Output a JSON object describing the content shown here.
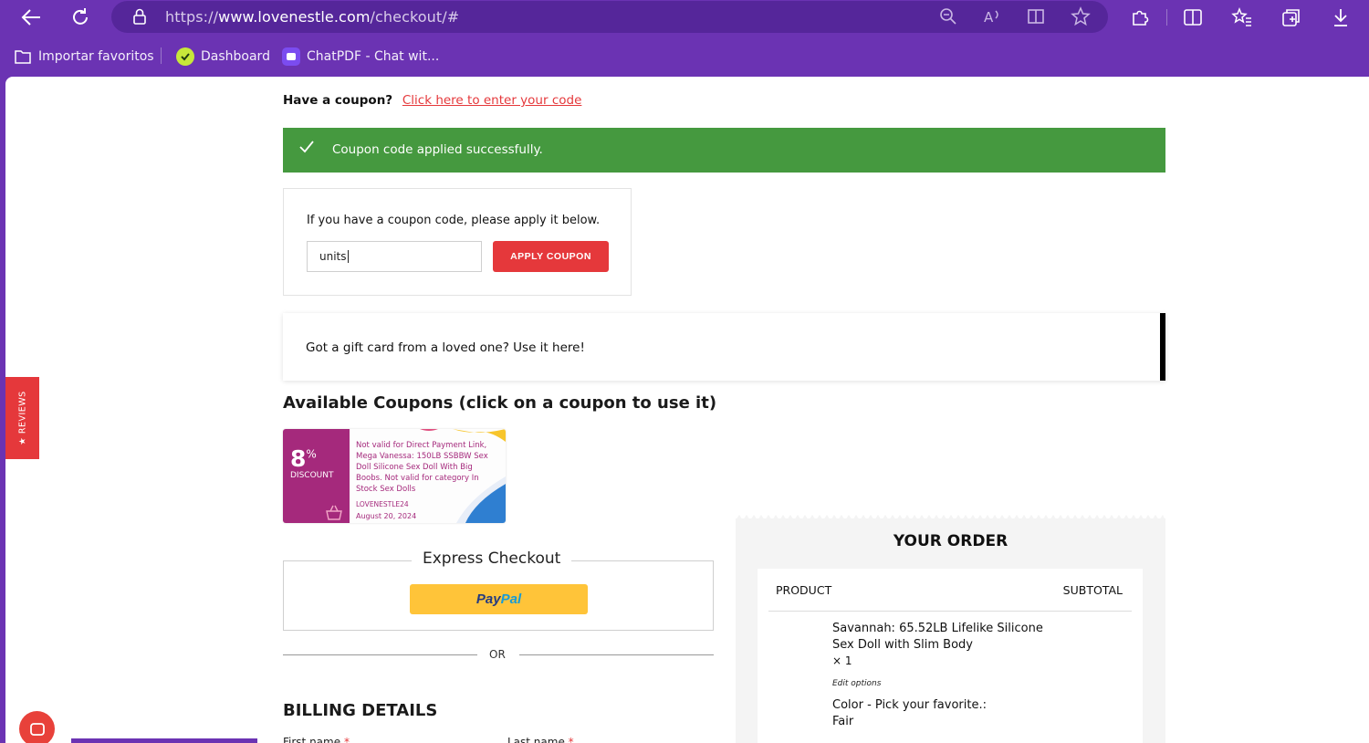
{
  "browser": {
    "url_prefix": "https://",
    "url_host": "www.lovenestle.com",
    "url_path": "/checkout/#",
    "bookmarks": [
      {
        "label": "Importar favoritos"
      },
      {
        "label": "Dashboard"
      },
      {
        "label": "ChatPDF - Chat wit..."
      }
    ]
  },
  "coupon_prompt": {
    "question": "Have a coupon?",
    "link": "Click here to enter your code"
  },
  "notice": {
    "message": "Coupon code applied successfully."
  },
  "coupon_form": {
    "label": "If you have a coupon code, please apply it below.",
    "value": "units",
    "button": "APPLY COUPON"
  },
  "gift_card": {
    "text": "Got a gift card from a loved one? Use it here!"
  },
  "available_coupons": {
    "title": "Available Coupons (click on a coupon to use it)",
    "items": [
      {
        "amount": "8",
        "unit": "%",
        "label": "DISCOUNT",
        "description": "Not valid for Direct Payment Link, Mega Vanessa: 150LB SSBBW Sex Doll Silicone Sex Doll With Big Boobs. Not valid for category In Stock Sex Dolls",
        "code": "LOVENESTLE24",
        "expiry": "August 20, 2024"
      }
    ]
  },
  "express_checkout": {
    "title": "Express Checkout",
    "paypal_a": "Pay",
    "paypal_b": "Pal"
  },
  "divider": {
    "text": "OR"
  },
  "billing": {
    "title": "BILLING DETAILS",
    "first_name": "First name",
    "last_name": "Last name",
    "required_mark": "*"
  },
  "order": {
    "title": "YOUR ORDER",
    "col_product": "PRODUCT",
    "col_subtotal": "SUBTOTAL",
    "item_name": "Savannah: 65.52LB Lifelike Silicone Sex Doll with Slim Body",
    "item_qty": "× 1",
    "edit_options": "Edit options",
    "option_line1": "Color - Pick your favorite.:",
    "option_line2": "Fair"
  },
  "reviews_tab": {
    "label": "★ REVIEWS"
  },
  "colors": {
    "browser_chrome": "#6b33b3",
    "accent_red": "#e5383b",
    "success_green": "#45993f",
    "paypal_yellow": "#ffc439",
    "coupon_magenta": "#a5297c"
  }
}
